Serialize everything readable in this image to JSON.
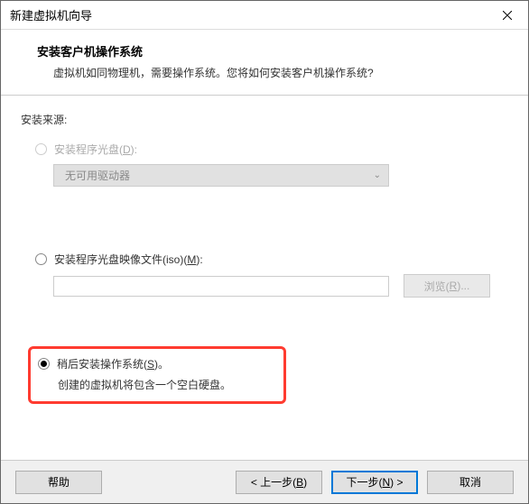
{
  "window": {
    "title": "新建虚拟机向导"
  },
  "header": {
    "title": "安装客户机操作系统",
    "subtitle": "虚拟机如同物理机，需要操作系统。您将如何安装客户机操作系统?"
  },
  "content": {
    "source_label": "安装来源:",
    "option_disc": {
      "label_prefix": "安装程序光盘(",
      "mnemonic": "D",
      "label_suffix": "):",
      "dropdown_value": "无可用驱动器"
    },
    "option_iso": {
      "label_prefix": "安装程序光盘映像文件(iso)(",
      "mnemonic": "M",
      "label_suffix": "):",
      "browse_prefix": "浏览(",
      "browse_mnemonic": "R",
      "browse_suffix": ")..."
    },
    "option_later": {
      "label_prefix": "稍后安装操作系统(",
      "mnemonic": "S",
      "label_suffix": ")。",
      "hint": "创建的虚拟机将包含一个空白硬盘。"
    }
  },
  "footer": {
    "help": "帮助",
    "back_prefix": "< 上一步(",
    "back_mnemonic": "B",
    "back_suffix": ")",
    "next_prefix": "下一步(",
    "next_mnemonic": "N",
    "next_suffix": ") >",
    "cancel": "取消"
  }
}
